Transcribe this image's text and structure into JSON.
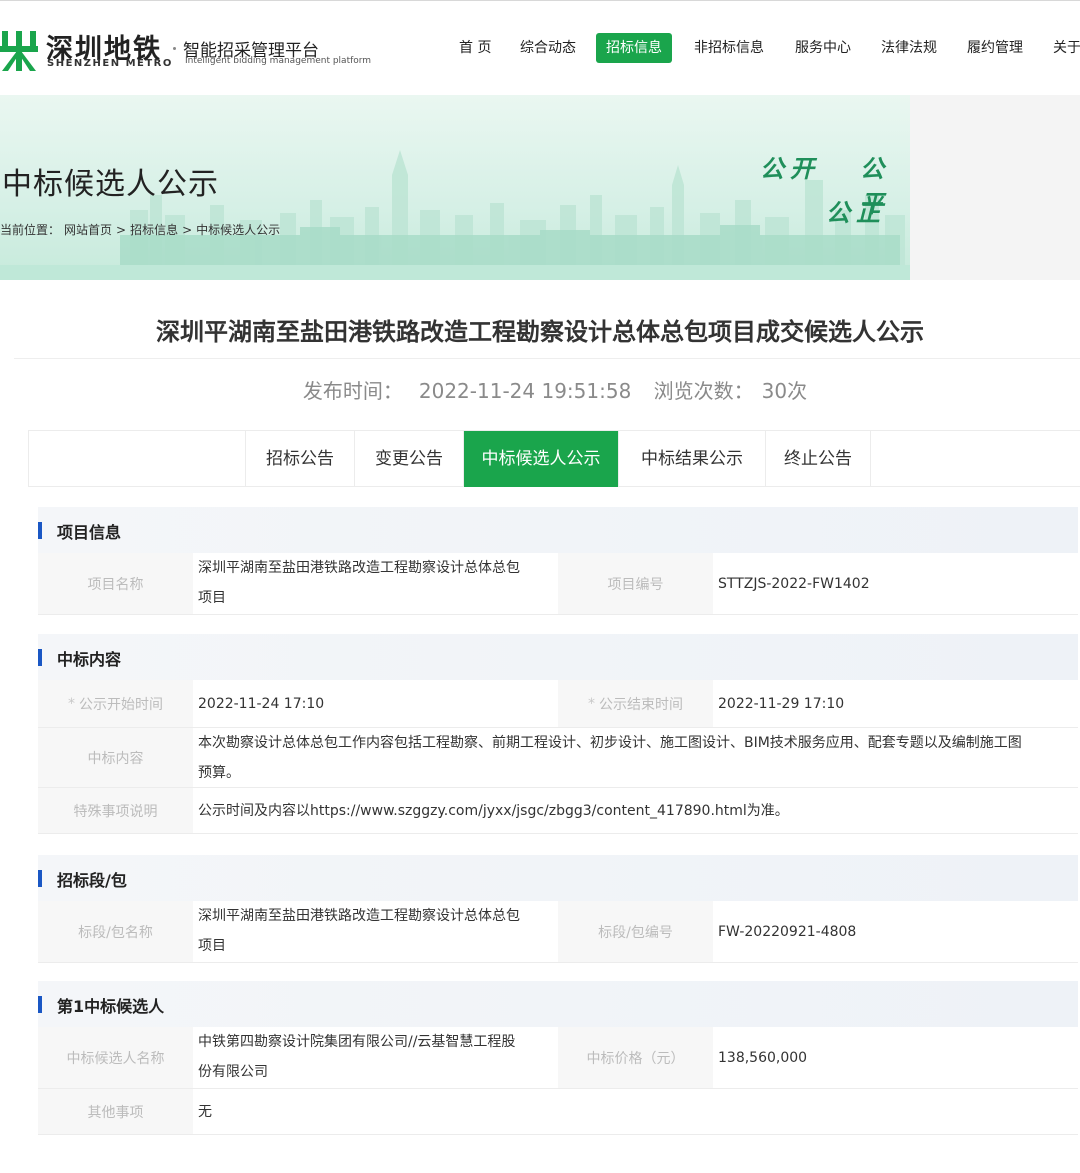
{
  "header": {
    "logo_cn": "深圳地铁",
    "logo_en": "SHENZHEN METRO",
    "platform_cn": "智能招采管理平台",
    "platform_en": "Intelligent bidding management platform",
    "nav": [
      "首 页",
      "综合动态",
      "招标信息",
      "非招标信息",
      "服务中心",
      "法律法规",
      "履约管理",
      "关于"
    ],
    "active_nav": "招标信息"
  },
  "banner": {
    "title": "中标候选人公示",
    "breadcrumb": [
      "当前位置：",
      "网站首页",
      ">",
      "招标信息",
      ">",
      "中标候选人公示"
    ],
    "slogans": [
      "公开",
      "公平",
      "公正"
    ]
  },
  "notice": {
    "title": "深圳平湖南至盐田港铁路改造工程勘察设计总体总包项目成交候选人公示",
    "publish_label": "发布时间：",
    "publish_time": "2022-11-24 19:51:58",
    "views_label": "浏览次数：",
    "views": "30次"
  },
  "tabs": [
    "招标公告",
    "变更公告",
    "中标候选人公示",
    "中标结果公示",
    "终止公告"
  ],
  "active_tab": "中标候选人公示",
  "sections": {
    "project_info": {
      "heading": "项目信息",
      "name_label": "项目名称",
      "name_line1": "深圳平湖南至盐田港铁路改造工程勘察设计总体总包",
      "name_line2": "项目",
      "code_label": "项目编号",
      "code_value": "STTZJS-2022-FW1402"
    },
    "bid_content": {
      "heading": "中标内容",
      "start_label": "公示开始时间",
      "start_value": "2022-11-24 17:10",
      "end_label": "公示结束时间",
      "end_value": "2022-11-29 17:10",
      "content_label": "中标内容",
      "content_line1": "本次勘察设计总体总包工作内容包括工程勘察、前期工程设计、初步设计、施工图设计、BIM技术服务应用、配套专题以及编制施工图",
      "content_line2": "预算。",
      "special_label": "特殊事项说明",
      "special_value": "公示时间及内容以https://www.szggzy.com/jyxx/jsgc/zbgg3/content_417890.html为准。"
    },
    "lot": {
      "heading": "招标段/包",
      "name_label": "标段/包名称",
      "name_line1": "深圳平湖南至盐田港铁路改造工程勘察设计总体总包",
      "name_line2": "项目",
      "code_label": "标段/包编号",
      "code_value": "FW-20220921-4808"
    },
    "candidate": {
      "heading": "第1中标候选人",
      "name_label": "中标候选人名称",
      "name_line1": "中铁第四勘察设计院集团有限公司//云基智慧工程股",
      "name_line2": "份有限公司",
      "price_label": "中标价格（元）",
      "price_value": "138,560,000",
      "other_label": "其他事项",
      "other_value": "无"
    }
  },
  "colors": {
    "brand_green": "#1aa54c",
    "section_bar_blue": "#1a57c4",
    "slogan_green": "#1f8f5a"
  }
}
